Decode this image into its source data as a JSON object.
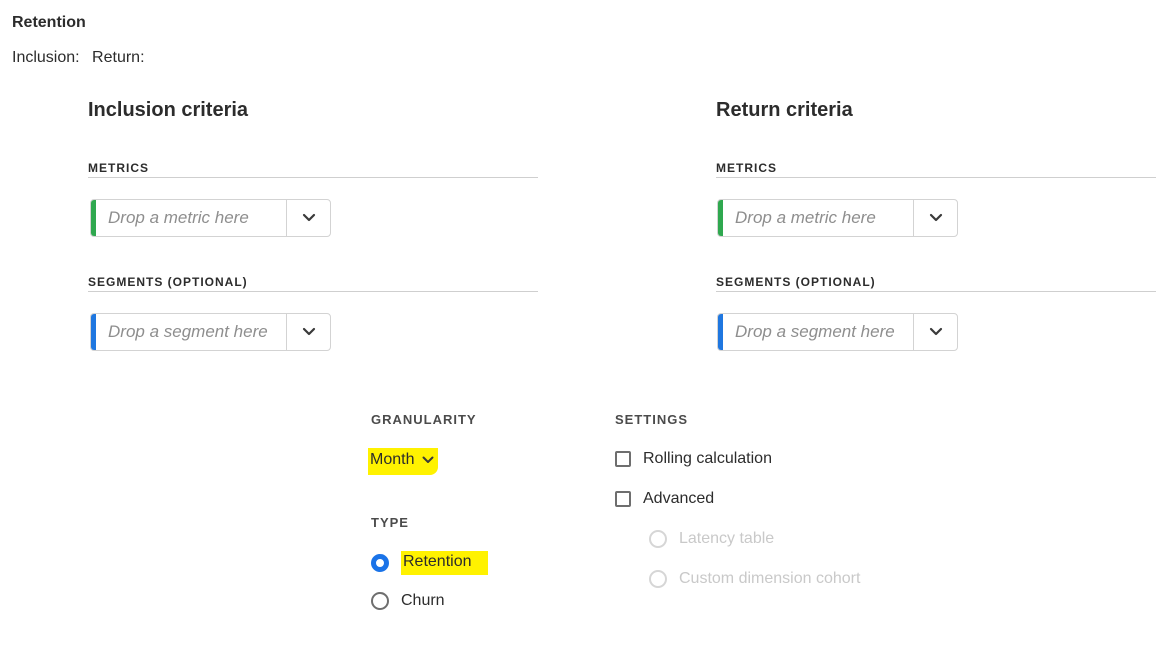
{
  "header": {
    "title": "Retention",
    "inclusion_label": "Inclusion:",
    "return_label": "Return:"
  },
  "inclusion": {
    "title": "Inclusion criteria",
    "metrics_label": "METRICS",
    "metric_placeholder": "Drop a metric here",
    "segments_label": "SEGMENTS (OPTIONAL)",
    "segment_placeholder": "Drop a segment here"
  },
  "return": {
    "title": "Return criteria",
    "metrics_label": "METRICS",
    "metric_placeholder": "Drop a metric here",
    "segments_label": "SEGMENTS (OPTIONAL)",
    "segment_placeholder": "Drop a segment here"
  },
  "granularity": {
    "label": "GRANULARITY",
    "value": "Month"
  },
  "type": {
    "label": "TYPE",
    "options": [
      {
        "label": "Retention",
        "selected": true
      },
      {
        "label": "Churn",
        "selected": false
      }
    ]
  },
  "settings": {
    "label": "SETTINGS",
    "rolling": "Rolling calculation",
    "advanced": "Advanced",
    "latency": "Latency table",
    "custom_cohort": "Custom dimension cohort"
  },
  "colors": {
    "metric_accent": "#2fa84f",
    "segment_accent": "#1f77e0",
    "highlight": "#fff200",
    "radio_selected": "#1a73e8"
  },
  "icons": {
    "dropdown": "chevron-down-icon"
  }
}
